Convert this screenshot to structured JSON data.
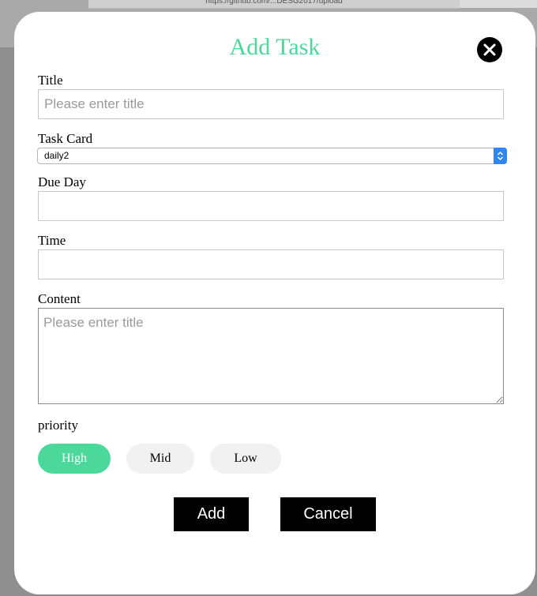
{
  "browser": {
    "url": "https://github.com/...DESG2017/upload"
  },
  "modal": {
    "title": "Add Task",
    "fields": {
      "title_label": "Title",
      "title_placeholder": "Please enter title",
      "task_card_label": "Task Card",
      "task_card_value": "daily2",
      "due_day_label": "Due Day",
      "due_day_value": "",
      "time_label": "Time",
      "time_value": "",
      "content_label": "Content",
      "content_placeholder": "Please enter title"
    },
    "priority": {
      "label": "priority",
      "options": [
        "High",
        "Mid",
        "Low"
      ],
      "selected": "High"
    },
    "buttons": {
      "add": "Add",
      "cancel": "Cancel"
    }
  },
  "colors": {
    "accent": "#4cd89a",
    "button": "#000000",
    "select_arrow": "#2f86f2"
  }
}
